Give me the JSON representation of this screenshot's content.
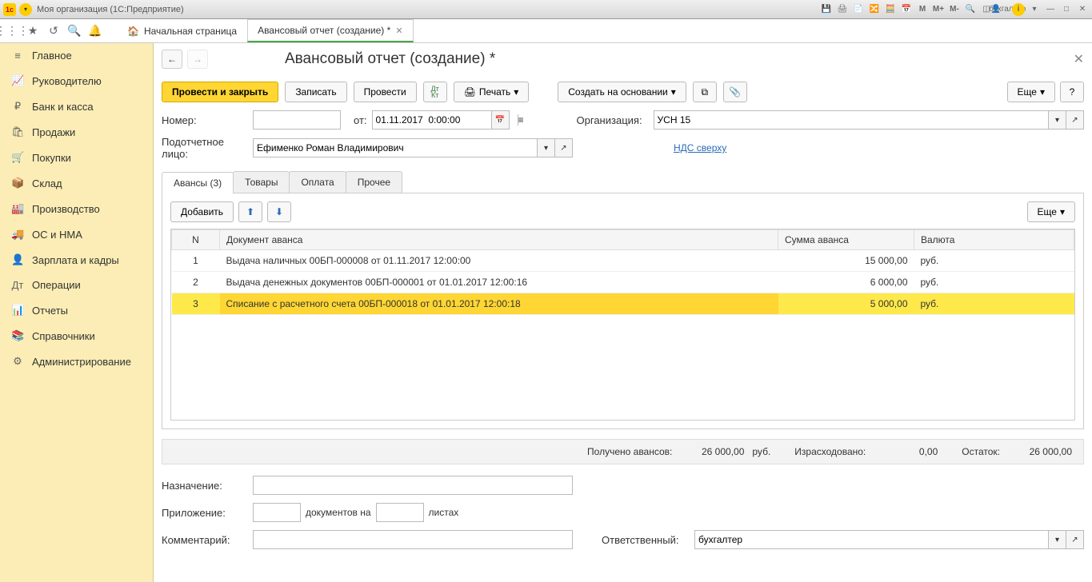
{
  "window": {
    "title": "Моя организация  (1С:Предприятие)",
    "user": "бухгалтер"
  },
  "tabs": {
    "start": "Начальная страница",
    "active": "Авансовый отчет (создание) *"
  },
  "sidebar": {
    "items": [
      {
        "icon": "≡",
        "label": "Главное"
      },
      {
        "icon": "📈",
        "label": "Руководителю"
      },
      {
        "icon": "₽",
        "label": "Банк и касса"
      },
      {
        "icon": "🛍",
        "label": "Продажи"
      },
      {
        "icon": "🛒",
        "label": "Покупки"
      },
      {
        "icon": "📦",
        "label": "Склад"
      },
      {
        "icon": "🏭",
        "label": "Производство"
      },
      {
        "icon": "🚚",
        "label": "ОС и НМА"
      },
      {
        "icon": "👤",
        "label": "Зарплата и кадры"
      },
      {
        "icon": "Дт",
        "label": "Операции"
      },
      {
        "icon": "📊",
        "label": "Отчеты"
      },
      {
        "icon": "📚",
        "label": "Справочники"
      },
      {
        "icon": "⚙",
        "label": "Администрирование"
      }
    ]
  },
  "page": {
    "title": "Авансовый отчет (создание) *",
    "buttons": {
      "process_close": "Провести и закрыть",
      "save": "Записать",
      "process": "Провести",
      "print": "Печать",
      "create_based": "Создать на основании",
      "more": "Еще"
    },
    "fields": {
      "number_label": "Номер:",
      "number_value": "",
      "from_label": "от:",
      "from_value": "01.11.2017  0:00:00",
      "org_label": "Организация:",
      "org_value": "УСН 15",
      "person_label": "Подотчетное лицо:",
      "person_value": "Ефименко Роман Владимирович",
      "nds_link": "НДС сверху"
    },
    "doc_tabs": [
      "Авансы (3)",
      "Товары",
      "Оплата",
      "Прочее"
    ],
    "grid": {
      "add": "Добавить",
      "more": "Еще",
      "headers": {
        "n": "N",
        "doc": "Документ аванса",
        "sum": "Сумма аванса",
        "cur": "Валюта"
      },
      "rows": [
        {
          "n": "1",
          "doc": "Выдача наличных 00БП-000008 от 01.11.2017 12:00:00",
          "sum": "15 000,00",
          "cur": "руб."
        },
        {
          "n": "2",
          "doc": "Выдача денежных документов 00БП-000001 от 01.01.2017 12:00:16",
          "sum": "6 000,00",
          "cur": "руб."
        },
        {
          "n": "3",
          "doc": "Списание с расчетного счета 00БП-000018 от 01.01.2017 12:00:18",
          "sum": "5 000,00",
          "cur": "руб."
        }
      ]
    },
    "summary": {
      "received_label": "Получено авансов:",
      "received_value": "26 000,00",
      "received_cur": "руб.",
      "spent_label": "Израсходовано:",
      "spent_value": "0,00",
      "balance_label": "Остаток:",
      "balance_value": "26 000,00"
    },
    "bottom": {
      "purpose_label": "Назначение:",
      "purpose_value": "",
      "attach_label": "Приложение:",
      "attach_value1": "",
      "attach_mid": "документов на",
      "attach_value2": "",
      "attach_end": "листах",
      "comment_label": "Комментарий:",
      "comment_value": "",
      "resp_label": "Ответственный:",
      "resp_value": "бухгалтер"
    }
  }
}
